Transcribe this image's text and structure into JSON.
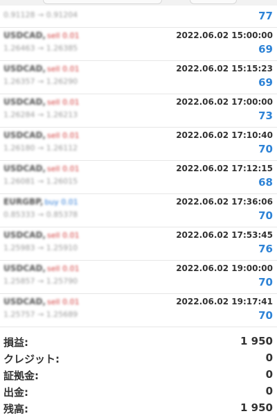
{
  "trades": [
    {
      "symbol": "",
      "side": "",
      "prices": "0.91128 → 0.91204",
      "time": "",
      "profit": "77"
    },
    {
      "symbol": "USDCAD,",
      "side": "sell 0.01",
      "prices": "1.26463 → 1.26385",
      "time": "2022.06.02 15:00:00",
      "profit": "69"
    },
    {
      "symbol": "USDCAD,",
      "side": "sell 0.01",
      "prices": "1.26357 → 1.26290",
      "time": "2022.06.02 15:15:23",
      "profit": "69"
    },
    {
      "symbol": "USDCAD,",
      "side": "sell 0.01",
      "prices": "1.26284 → 1.26213",
      "time": "2022.06.02 17:00:00",
      "profit": "73"
    },
    {
      "symbol": "USDCAD,",
      "side": "sell 0.01",
      "prices": "1.26180 → 1.26112",
      "time": "2022.06.02 17:10:40",
      "profit": "70"
    },
    {
      "symbol": "USDCAD,",
      "side": "sell 0.01",
      "prices": "1.26081 → 1.26015",
      "time": "2022.06.02 17:12:15",
      "profit": "68"
    },
    {
      "symbol": "EURGBP,",
      "side": "buy 0.01",
      "prices": "0.85333 → 0.85378",
      "time": "2022.06.02 17:36:06",
      "profit": "70"
    },
    {
      "symbol": "USDCAD,",
      "side": "sell 0.01",
      "prices": "1.25983 → 1.25910",
      "time": "2022.06.02 17:53:45",
      "profit": "76"
    },
    {
      "symbol": "USDCAD,",
      "side": "sell 0.01",
      "prices": "1.25857 → 1.25790",
      "time": "2022.06.02 19:00:00",
      "profit": "70"
    },
    {
      "symbol": "USDCAD,",
      "side": "sell 0.01",
      "prices": "1.25757 → 1.25689",
      "time": "2022.06.02 19:17:41",
      "profit": "70"
    }
  ],
  "summary": [
    {
      "label": "損益:",
      "value": "1 950"
    },
    {
      "label": "クレジット:",
      "value": "0"
    },
    {
      "label": "証拠金:",
      "value": "0"
    },
    {
      "label": "出金:",
      "value": "0"
    },
    {
      "label": "残高:",
      "value": "1 950"
    }
  ],
  "colors": {
    "profit": "#2e83d6",
    "sell": "#d33a3a",
    "buy": "#2e7bd6"
  }
}
